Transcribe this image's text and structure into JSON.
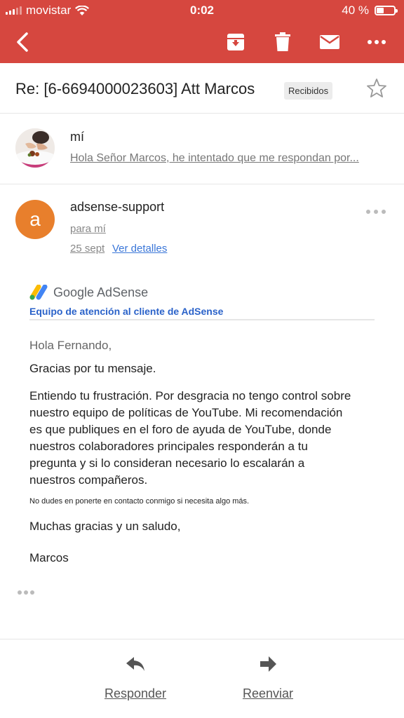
{
  "status_bar": {
    "carrier": "movistar",
    "time": "0:02",
    "battery": "40 %",
    "battery_level": 0.4
  },
  "toolbar": {
    "icons": [
      "back-icon",
      "archive-icon",
      "trash-icon",
      "mail-icon",
      "more-icon"
    ]
  },
  "thread": {
    "subject": "Re: [6-6694000023603] Att Marcos",
    "label": "Recibidos"
  },
  "collapsed_message": {
    "sender": "mí",
    "snippet": "Hola Señor Marcos, he intentado que me respondan por..."
  },
  "message": {
    "avatar_letter": "a",
    "avatar_color": "#e87f2c",
    "sender": "adsense-support",
    "to": "para mí",
    "date": "25 sept",
    "details_link": "Ver detalles",
    "brand": "Google AdSense",
    "team": "Equipo de atención al cliente de AdSense",
    "greeting": "Hola Fernando,",
    "paragraph1": "Gracias por tu mensaje.",
    "paragraph2_lines": [
      "Entiendo tu frustración. Por desgracia no tengo control sobre",
      "nuestro equipo de políticas de YouTube. Mi recomendación",
      "es que publiques en el foro de ayuda de YouTube, donde",
      "nuestros colaboradores principales responderán a tu",
      "pregunta y si lo consideran necesario lo escalarán a",
      "nuestros compañeros."
    ],
    "small_note": "No dudes en ponerte en contacto conmigo si necesita algo más.",
    "closing": "Muchas gracias y un saludo,",
    "signature": "Marcos"
  },
  "actions": {
    "reply": "Responder",
    "forward": "Reenviar"
  },
  "colors": {
    "toolbar_red": "#d6473f",
    "link_blue": "#3a76d8",
    "team_blue": "#2a62c9"
  }
}
